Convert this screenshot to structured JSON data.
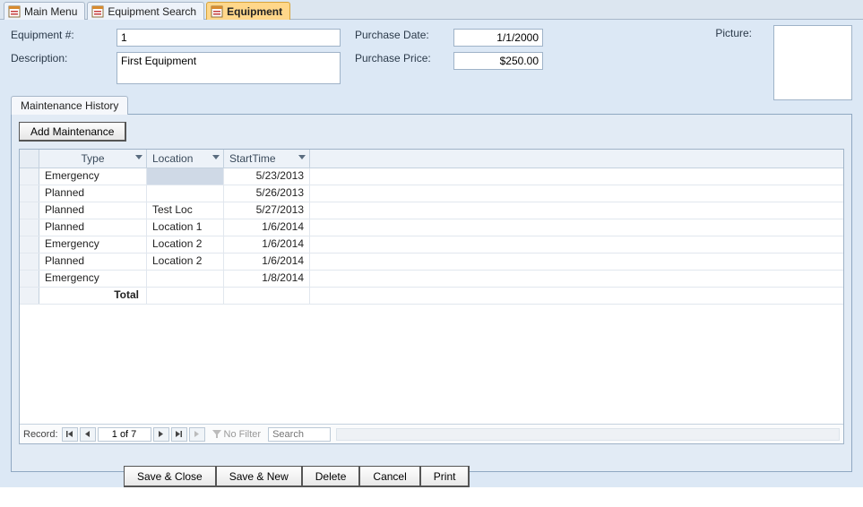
{
  "tabs": [
    {
      "label": "Main Menu",
      "active": false
    },
    {
      "label": "Equipment Search",
      "active": false
    },
    {
      "label": "Equipment",
      "active": true
    }
  ],
  "form": {
    "equipNumLabel": "Equipment #:",
    "equipNum": "1",
    "descriptionLabel": "Description:",
    "description": "First Equipment",
    "purchaseDateLabel": "Purchase Date:",
    "purchaseDate": "1/1/2000",
    "purchasePriceLabel": "Purchase Price:",
    "purchasePrice": "$250.00",
    "pictureLabel": "Picture:"
  },
  "subtab": {
    "label": "Maintenance History"
  },
  "addMaintBtn": "Add Maintenance",
  "grid": {
    "columns": {
      "type": "Type",
      "location": "Location",
      "startTime": "StartTime"
    },
    "rows": [
      {
        "type": "Emergency",
        "location": "",
        "startTime": "5/23/2013",
        "locSelected": true
      },
      {
        "type": "Planned",
        "location": "",
        "startTime": "5/26/2013"
      },
      {
        "type": "Planned",
        "location": "Test Loc",
        "startTime": "5/27/2013"
      },
      {
        "type": "Planned",
        "location": "Location 1",
        "startTime": "1/6/2014"
      },
      {
        "type": "Emergency",
        "location": "Location 2",
        "startTime": "1/6/2014"
      },
      {
        "type": "Planned",
        "location": "Location 2",
        "startTime": "1/6/2014"
      },
      {
        "type": "Emergency",
        "location": "",
        "startTime": "1/8/2014"
      }
    ],
    "totalLabel": "Total"
  },
  "recnav": {
    "label": "Record:",
    "position": "1 of 7",
    "noFilter": "No Filter",
    "searchPlaceholder": "Search"
  },
  "buttons": {
    "saveClose": "Save & Close",
    "saveNew": "Save & New",
    "delete": "Delete",
    "cancel": "Cancel",
    "print": "Print"
  }
}
